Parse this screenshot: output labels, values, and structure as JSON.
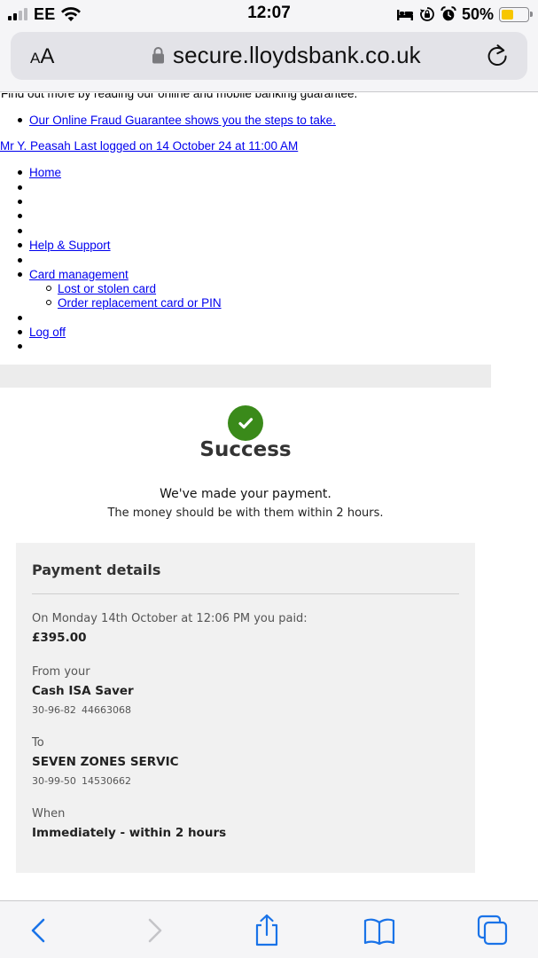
{
  "status_bar": {
    "carrier": "EE",
    "time": "12:07",
    "battery_percent": "50%",
    "battery_level": 0.5,
    "icons": [
      "signal-icon",
      "wifi-icon",
      "bed-icon",
      "orientation-lock-icon",
      "alarm-icon",
      "battery-icon"
    ]
  },
  "browser": {
    "text_size_small": "A",
    "text_size_big": "A",
    "url": "secure.lloydsbank.co.uk",
    "toolbar_icons": [
      "back-icon",
      "forward-icon",
      "share-icon",
      "bookmarks-icon",
      "tabs-icon"
    ]
  },
  "page": {
    "cut_text": "Find out more by reading our online and mobile banking guarantee.",
    "fraud_link": "Our Online Fraud Guarantee shows you the steps to take.",
    "user_link": "Mr Y. Peasah Last logged on 14 October 24 at 11:00 AM",
    "nav": {
      "home": "Home",
      "help_support": "Help & Support",
      "card_management": "Card management",
      "lost_card": "Lost or stolen card",
      "order_replacement": "Order replacement card or PIN",
      "log_off": "Log off"
    },
    "success": {
      "title": "Success",
      "message": "We've made your payment.",
      "sub_message": "The money should be with them within 2 hours."
    },
    "payment_details": {
      "title": "Payment details",
      "paid_label": "On Monday 14th October at 12:06 PM you paid:",
      "amount": "£395.00",
      "from_label": "From your",
      "from_account": "Cash ISA Saver",
      "from_sort_code": "30-96-82",
      "from_account_number": "44663068",
      "to_label": "To",
      "to_name": "SEVEN ZONES SERVIC",
      "to_sort_code": "30-99-50",
      "to_account_number": "14530662",
      "when_label": "When",
      "when_value": "Immediately - within 2 hours"
    }
  },
  "colors": {
    "link": "#0000ee",
    "success_green": "#3a8a1a",
    "card_background": "#f1f1f1",
    "battery_yellow": "#f7c600"
  }
}
